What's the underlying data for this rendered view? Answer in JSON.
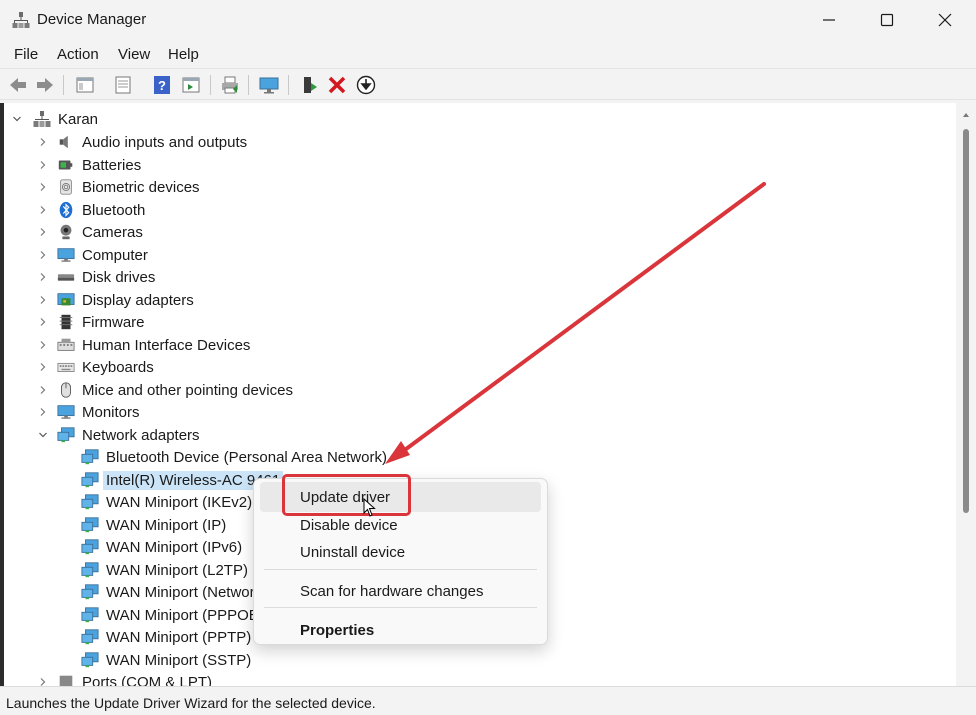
{
  "window": {
    "title": "Device Manager"
  },
  "menu": [
    "File",
    "Action",
    "View",
    "Help"
  ],
  "tree": {
    "root": "Karan",
    "categories": [
      {
        "label": "Audio inputs and outputs",
        "icon": "speaker-icon"
      },
      {
        "label": "Batteries",
        "icon": "battery-icon"
      },
      {
        "label": "Biometric devices",
        "icon": "fingerprint-icon"
      },
      {
        "label": "Bluetooth",
        "icon": "bluetooth-icon"
      },
      {
        "label": "Cameras",
        "icon": "camera-icon"
      },
      {
        "label": "Computer",
        "icon": "monitor-icon"
      },
      {
        "label": "Disk drives",
        "icon": "disk-icon"
      },
      {
        "label": "Display adapters",
        "icon": "display-adapter-icon"
      },
      {
        "label": "Firmware",
        "icon": "chip-icon"
      },
      {
        "label": "Human Interface Devices",
        "icon": "keyboard-icon"
      },
      {
        "label": "Keyboards",
        "icon": "keyboard-icon"
      },
      {
        "label": "Mice and other pointing devices",
        "icon": "mouse-icon"
      },
      {
        "label": "Monitors",
        "icon": "monitor-icon"
      },
      {
        "label": "Network adapters",
        "icon": "network-icon"
      }
    ],
    "network_children": [
      "Bluetooth Device (Personal Area Network)",
      "Intel(R) Wireless-AC 9461",
      "WAN Miniport (IKEv2)",
      "WAN Miniport (IP)",
      "WAN Miniport (IPv6)",
      "WAN Miniport (L2TP)",
      "WAN Miniport (Network Monitor)",
      "WAN Miniport (PPPOE)",
      "WAN Miniport (PPTP)",
      "WAN Miniport (SSTP)"
    ],
    "after_network": "Ports (COM & LPT)"
  },
  "context_menu": {
    "update": "Update driver",
    "disable": "Disable device",
    "uninstall": "Uninstall device",
    "scan": "Scan for hardware changes",
    "properties": "Properties"
  },
  "status": "Launches the Update Driver Wizard for the selected device.",
  "colors": {
    "highlight": "#d9353b",
    "selection": "#cce4f7"
  }
}
